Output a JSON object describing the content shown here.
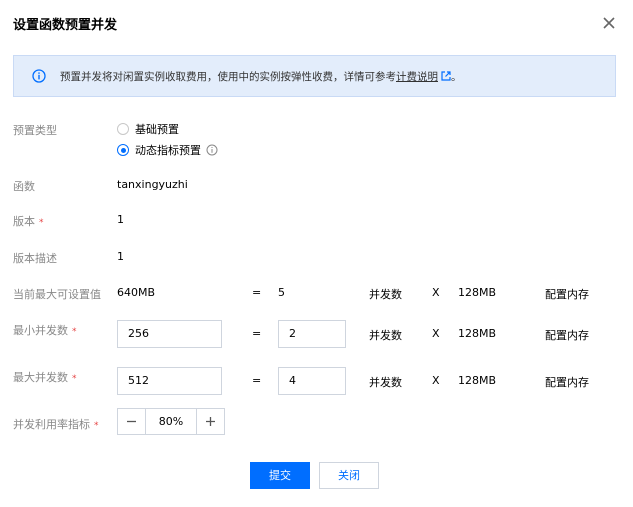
{
  "dialog": {
    "title": "设置函数预置并发",
    "notice_text": "预置并发将对闲置实例收取费用，使用中的实例按弹性收费，详情可参考",
    "notice_link": "计费说明",
    "notice_end": "。"
  },
  "provision_type": {
    "label": "预置类型",
    "options": [
      "基础预置",
      "动态指标预置"
    ],
    "selected": "动态指标预置"
  },
  "function": {
    "label": "函数",
    "value": "tanxingyuzhi"
  },
  "version": {
    "label": "版本",
    "required_mark": "*",
    "value": "1"
  },
  "version_desc": {
    "label": "版本描述",
    "value": "1"
  },
  "current_max": {
    "label": "当前最大可设置值",
    "memory": "640MB",
    "eq": "=",
    "count": "5",
    "unit": "并发数",
    "x": "X",
    "per_mem": "128MB",
    "mem_label": "配置内存"
  },
  "min_concurrency": {
    "label": "最小并发数",
    "required_mark": "*",
    "memory": "256",
    "eq": "=",
    "count": "2",
    "unit": "并发数",
    "x": "X",
    "per_mem": "128MB",
    "mem_label": "配置内存"
  },
  "max_concurrency": {
    "label": "最大并发数",
    "required_mark": "*",
    "memory": "512",
    "eq": "=",
    "count": "4",
    "unit": "并发数",
    "x": "X",
    "per_mem": "128MB",
    "mem_label": "配置内存"
  },
  "utilization": {
    "label": "并发利用率指标",
    "required_mark": "*",
    "value": "80%"
  },
  "footer": {
    "submit": "提交",
    "close": "关闭"
  },
  "colors": {
    "accent": "#006eff",
    "notice_bg": "#e3edfb",
    "required": "#e54545"
  }
}
